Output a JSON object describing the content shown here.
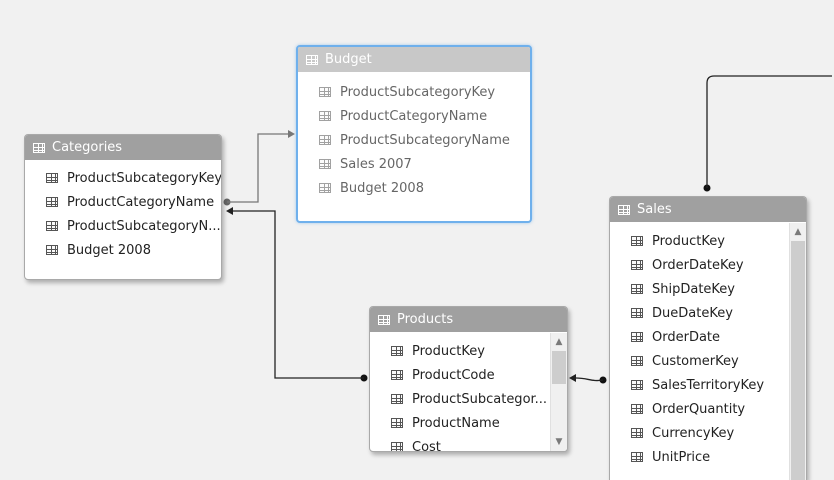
{
  "tables": {
    "categories": {
      "title": "Categories",
      "fields": [
        "ProductSubcategoryKey",
        "ProductCategoryName",
        "ProductSubcategoryN...",
        "Budget 2008"
      ]
    },
    "budget": {
      "title": "Budget",
      "fields": [
        "ProductSubcategoryKey",
        "ProductCategoryName",
        "ProductSubcategoryName",
        "Sales 2007",
        "Budget 2008"
      ]
    },
    "products": {
      "title": "Products",
      "fields": [
        "ProductKey",
        "ProductCode",
        "ProductSubcategor...",
        "ProductName",
        "Cost"
      ]
    },
    "sales": {
      "title": "Sales",
      "fields": [
        "ProductKey",
        "OrderDateKey",
        "ShipDateKey",
        "DueDateKey",
        "OrderDate",
        "CustomerKey",
        "SalesTerritoryKey",
        "OrderQuantity",
        "CurrencyKey",
        "UnitPrice"
      ]
    }
  },
  "colors": {
    "canvas": "#f1f1f1",
    "header": "#a0a0a0",
    "selection_border": "#6fb0ec",
    "relationship_line": "#222222",
    "faded_line": "#777777"
  },
  "icons": {
    "table": "table-grid-icon",
    "field": "column-grid-icon"
  }
}
